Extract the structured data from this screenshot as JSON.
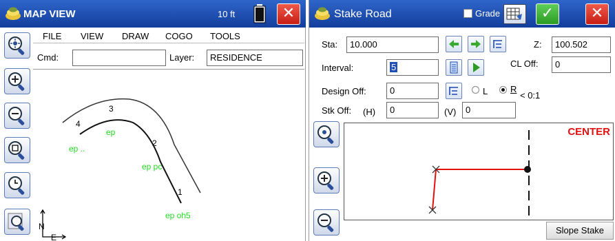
{
  "left": {
    "title": "MAP VIEW",
    "scale": "10 ft",
    "close_label": "✕",
    "menu": [
      "FILE",
      "VIEW",
      "DRAW",
      "COGO",
      "TOOLS"
    ],
    "cmd_label": "Cmd:",
    "cmd_value": "",
    "layer_label": "Layer:",
    "layer_value": "RESIDENCE",
    "points": {
      "p1": "1",
      "p2": "2",
      "p3": "3",
      "p4": "4",
      "ep": "ep",
      "ep_dots": "ep ..",
      "ep_pc": "ep pc",
      "ep_oh5": "ep oh5"
    },
    "north_label": "N",
    "east_label": "E"
  },
  "right": {
    "title": "Stake Road",
    "grade_label": "Grade",
    "sta_label": "Sta:",
    "sta_value": "10.000",
    "z_label": "Z:",
    "z_value": "100.502",
    "interval_label": "Interval:",
    "interval_value": "5",
    "cl_off_label": "CL Off:",
    "cl_off_value": "0",
    "design_off_label": "Design Off:",
    "design_off_value": "0",
    "side_l": "L",
    "side_r": "R",
    "slope_text": "< 0:1",
    "stk_off_label": "Stk Off:",
    "h_label": "(H)",
    "h_value": "0",
    "v_label": "(V)",
    "v_value": "0",
    "center_label": "CENTER",
    "slope_stake_label": "Slope Stake"
  },
  "colors": {
    "titlebar": "#1f50b5",
    "close_red": "#d9281d",
    "ok_green": "#2fa528",
    "point_label_green": "#22dd22",
    "stake_red": "#e01010"
  }
}
